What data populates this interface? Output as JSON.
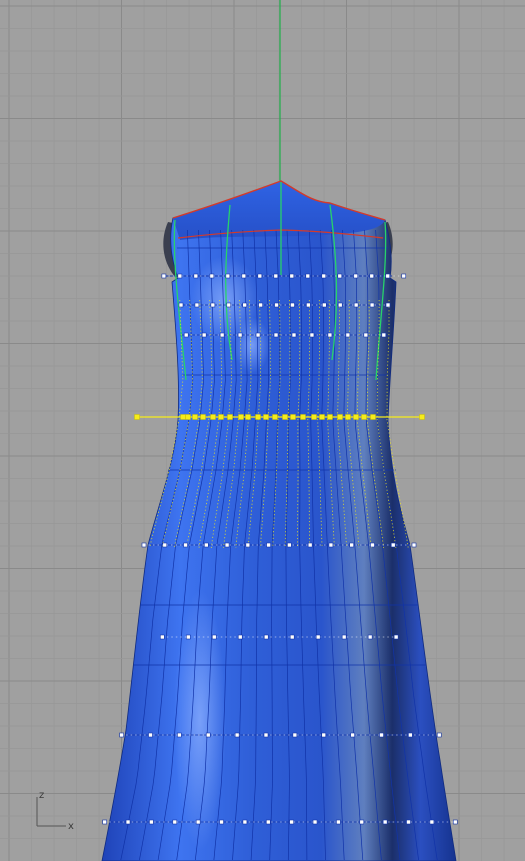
{
  "viewport": {
    "background": "#a0a0a0",
    "grid_minor_color": "#979797",
    "grid_major_color": "#8a8a8a",
    "world_axis_color": "#1fb04a"
  },
  "model": {
    "surface_color": "#2d5bd6",
    "isocurve_color": "#1133a8",
    "seam_color": "#d43a2a",
    "control_curve_color": "#27d36a",
    "selection_color": "#f6ec1a",
    "control_point_fill": "#ffffff"
  },
  "axis_indicator": {
    "z_label": "z",
    "x_label": "x"
  }
}
